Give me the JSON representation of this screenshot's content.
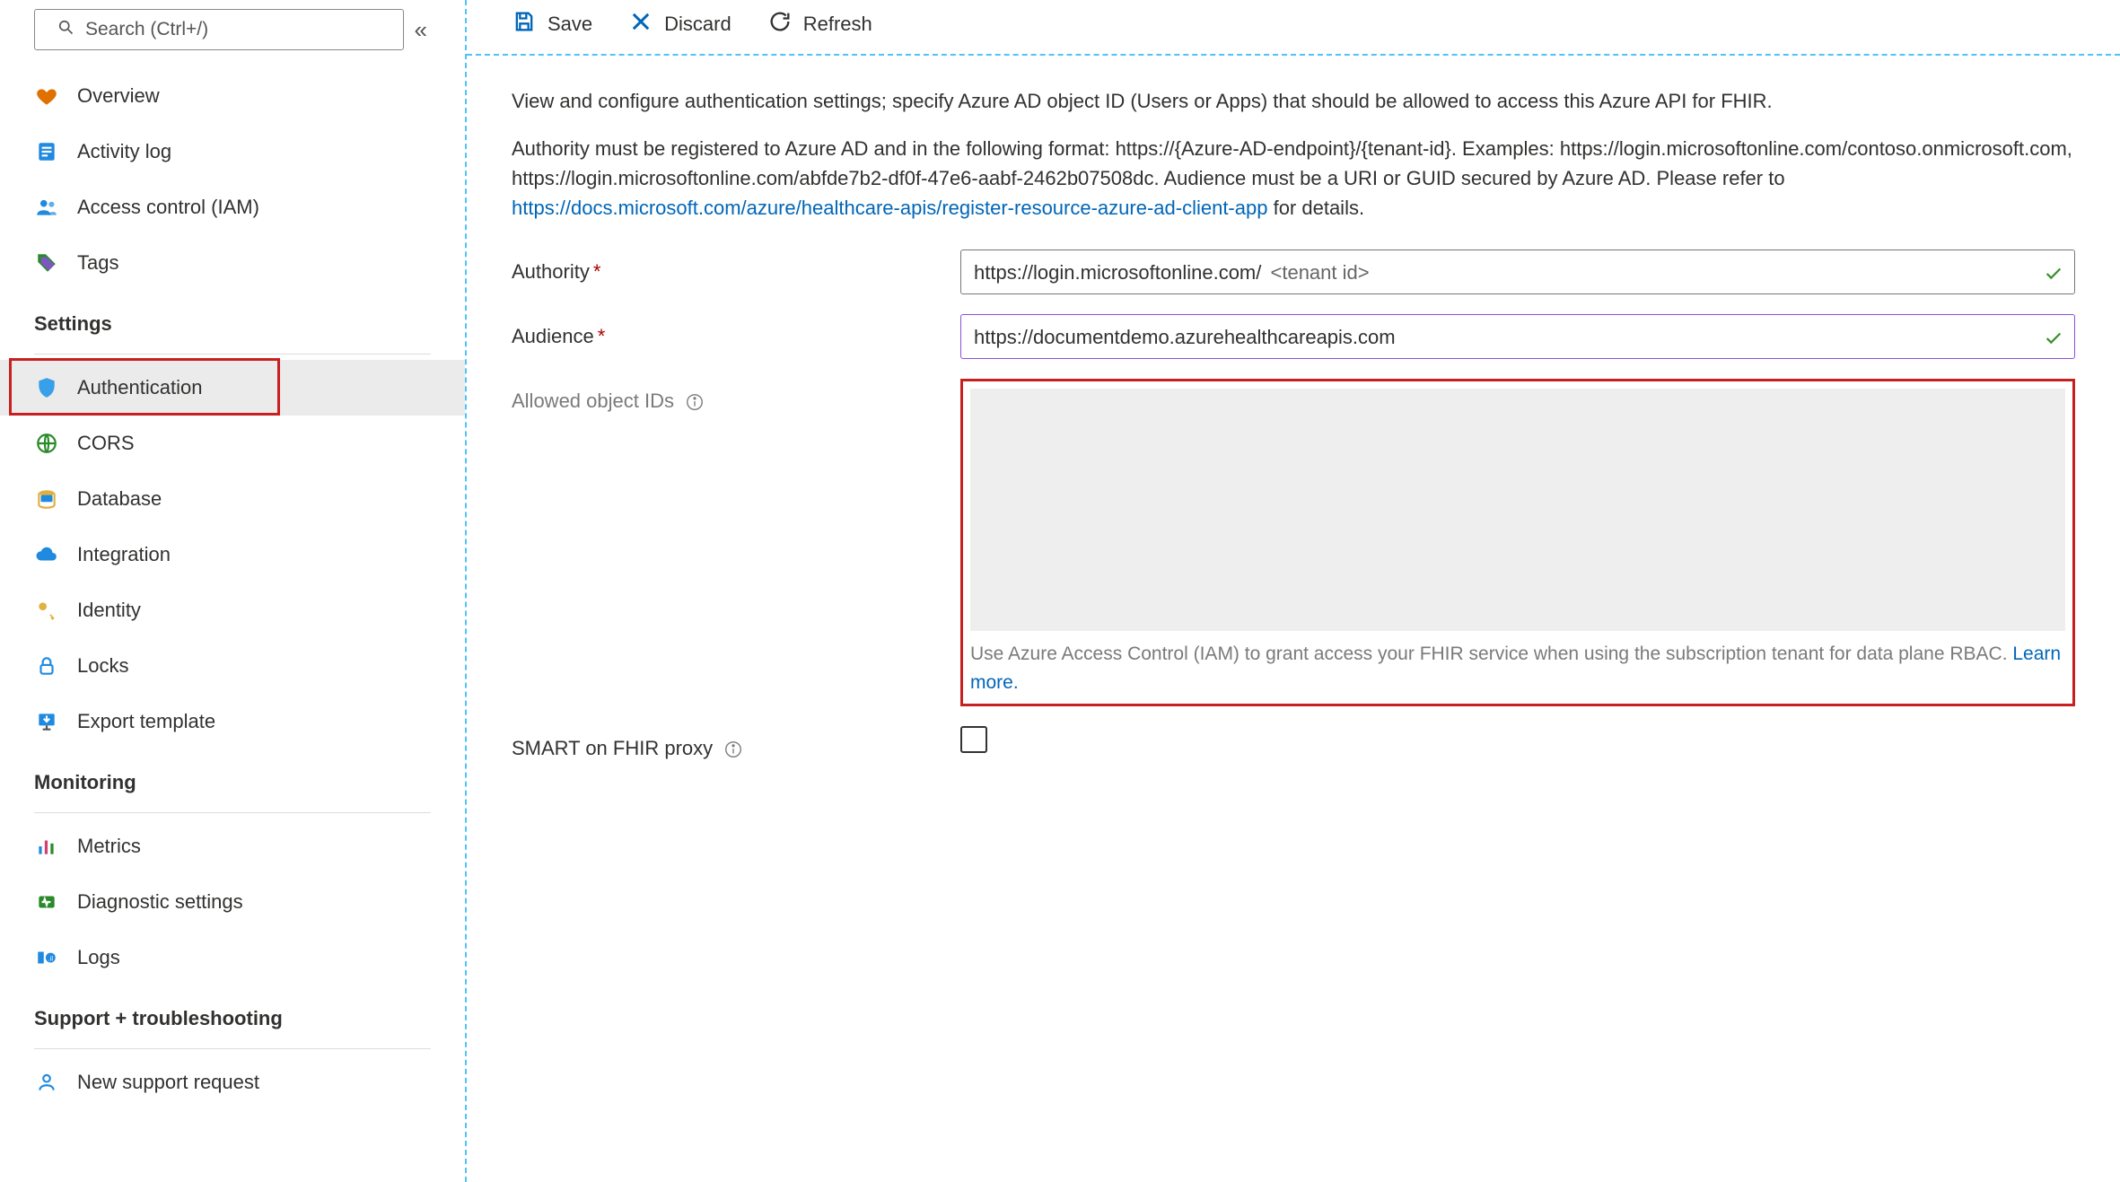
{
  "sidebar": {
    "search_placeholder": "Search (Ctrl+/)",
    "nav": [
      {
        "id": "overview",
        "label": "Overview"
      },
      {
        "id": "activity-log",
        "label": "Activity log"
      },
      {
        "id": "access-control",
        "label": "Access control (IAM)"
      },
      {
        "id": "tags",
        "label": "Tags"
      }
    ],
    "sections": [
      {
        "heading": "Settings",
        "items": [
          {
            "id": "authentication",
            "label": "Authentication",
            "selected": true
          },
          {
            "id": "cors",
            "label": "CORS"
          },
          {
            "id": "database",
            "label": "Database"
          },
          {
            "id": "integration",
            "label": "Integration"
          },
          {
            "id": "identity",
            "label": "Identity"
          },
          {
            "id": "locks",
            "label": "Locks"
          },
          {
            "id": "export-template",
            "label": "Export template"
          }
        ]
      },
      {
        "heading": "Monitoring",
        "items": [
          {
            "id": "metrics",
            "label": "Metrics"
          },
          {
            "id": "diagnostic",
            "label": "Diagnostic settings"
          },
          {
            "id": "logs",
            "label": "Logs"
          }
        ]
      },
      {
        "heading": "Support + troubleshooting",
        "items": [
          {
            "id": "new-support",
            "label": "New support request"
          }
        ]
      }
    ]
  },
  "toolbar": {
    "save": "Save",
    "discard": "Discard",
    "refresh": "Refresh"
  },
  "content": {
    "intro": "View and configure authentication settings; specify Azure AD object ID (Users or Apps) that should be allowed to access this Azure API for FHIR.",
    "para2_a": "Authority must be registered to Azure AD and in the following format: https://{Azure-AD-endpoint}/{tenant-id}. Examples: https://login.microsoftonline.com/contoso.onmicrosoft.com, https://login.microsoftonline.com/abfde7b2-df0f-47e6-aabf-2462b07508dc. Audience must be a URI or GUID secured by Azure AD. Please refer to ",
    "para2_link": "https://docs.microsoft.com/azure/healthcare-apis/register-resource-azure-ad-client-app",
    "para2_b": " for details.",
    "form": {
      "authority_label": "Authority",
      "authority_value": "https://login.microsoftonline.com/",
      "authority_hint": "<tenant id>",
      "audience_label": "Audience",
      "audience_value": "https://documentdemo.azurehealthcareapis.com",
      "allowed_label": "Allowed object IDs",
      "allowed_caption_a": "Use Azure Access Control (IAM) to grant access your FHIR service when using the subscription tenant for data plane RBAC. ",
      "allowed_caption_link": "Learn more.",
      "smart_label": "SMART on FHIR proxy"
    }
  }
}
